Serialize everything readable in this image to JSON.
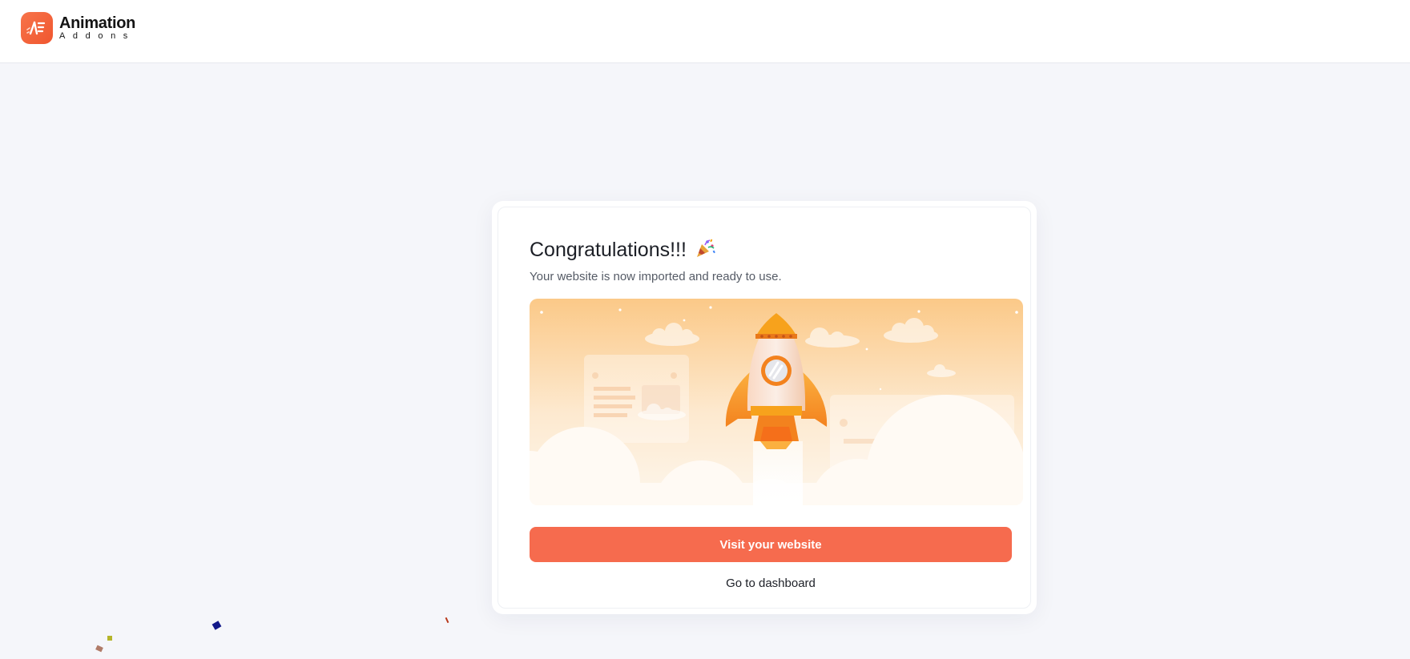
{
  "brand": {
    "name": "Animation",
    "tagline": "Addons",
    "accent_color": "#f66b4e"
  },
  "card": {
    "title": "Congratulations!!!",
    "title_icon": "party-popper-icon",
    "subtitle": "Your website is now imported and ready to use.",
    "illustration": "rocket-launch-illustration"
  },
  "actions": {
    "primary_label": "Visit your website",
    "secondary_label": "Go to dashboard"
  }
}
